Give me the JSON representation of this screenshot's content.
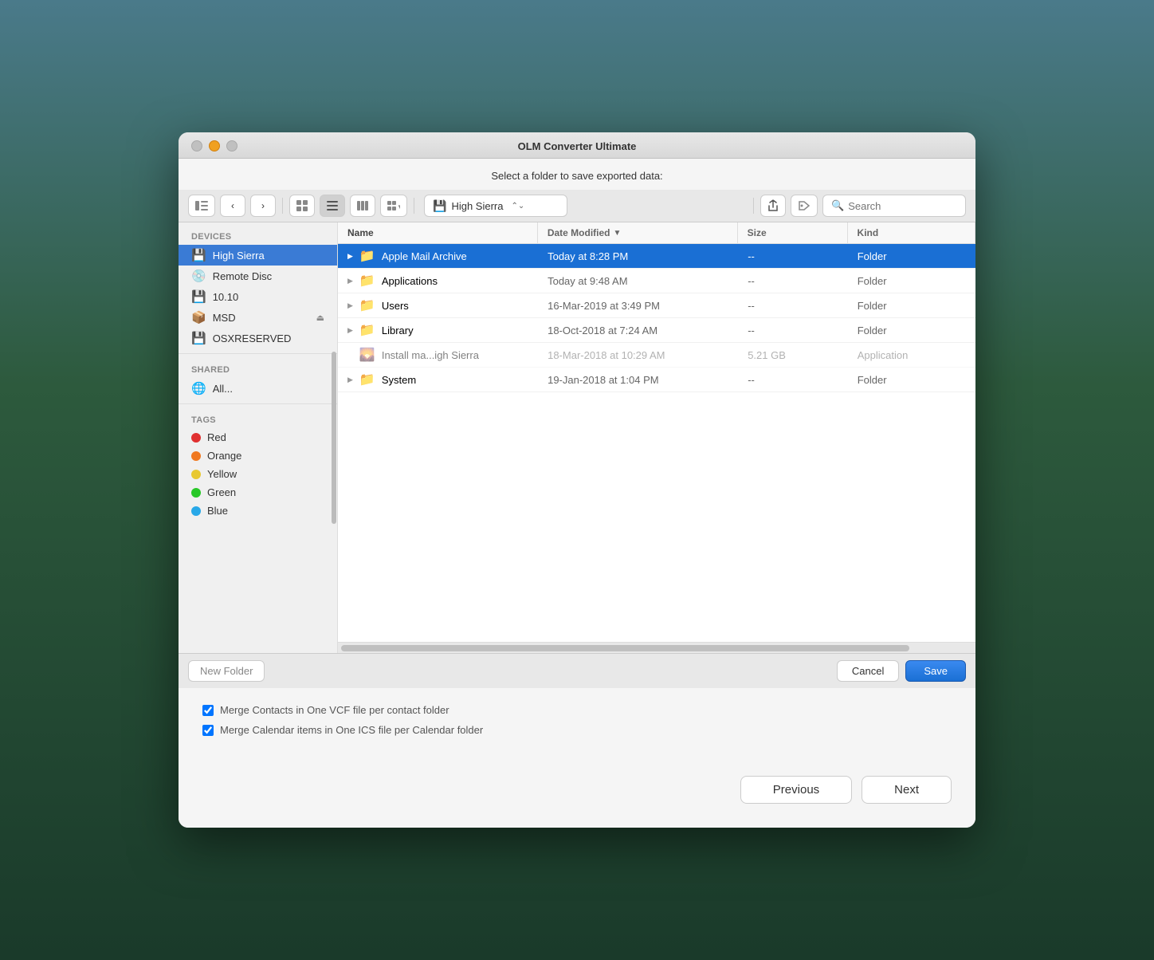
{
  "window": {
    "title": "OLM Converter Ultimate"
  },
  "dialog": {
    "header": "Select a folder to save exported data:"
  },
  "toolbar": {
    "location": "High Sierra",
    "location_icon": "💾",
    "search_placeholder": "Search",
    "btn_sidebar": "⊞",
    "btn_back": "‹",
    "btn_forward": "›",
    "btn_icon_view": "⊞",
    "btn_list_view": "≡",
    "btn_column_view": "⊟",
    "btn_group_view": "⊞",
    "btn_share": "↑",
    "btn_tag": "○"
  },
  "sidebar": {
    "devices_label": "Devices",
    "items_devices": [
      {
        "id": "high-sierra",
        "label": "High Sierra",
        "icon": "💾",
        "active": true
      },
      {
        "id": "remote-disc",
        "label": "Remote Disc",
        "icon": "💿",
        "active": false
      },
      {
        "id": "10-10",
        "label": "10.10",
        "icon": "💾",
        "active": false
      },
      {
        "id": "msd",
        "label": "MSD",
        "icon": "📦",
        "active": false,
        "eject": true
      },
      {
        "id": "osxreserved",
        "label": "OSXRESERVED",
        "icon": "💾",
        "active": false
      }
    ],
    "shared_label": "Shared",
    "items_shared": [
      {
        "id": "all",
        "label": "All...",
        "icon": "🌐",
        "active": false
      }
    ],
    "tags_label": "Tags",
    "items_tags": [
      {
        "id": "red",
        "label": "Red",
        "color": "#e03030"
      },
      {
        "id": "orange",
        "label": "Orange",
        "color": "#f07820"
      },
      {
        "id": "yellow",
        "label": "Yellow",
        "color": "#e8c830"
      },
      {
        "id": "green",
        "label": "Green",
        "color": "#28c828"
      },
      {
        "id": "blue",
        "label": "Blue",
        "color": "#28a8e8"
      }
    ]
  },
  "file_list": {
    "columns": {
      "name": "Name",
      "date_modified": "Date Modified",
      "size": "Size",
      "kind": "Kind"
    },
    "rows": [
      {
        "id": "apple-mail-archive",
        "name": "Apple Mail Archive",
        "icon": "📁",
        "date": "Today at 8:28 PM",
        "size": "--",
        "kind": "Folder",
        "selected": true,
        "expanded": true
      },
      {
        "id": "applications",
        "name": "Applications",
        "icon": "📁",
        "date": "Today at 9:48 AM",
        "size": "--",
        "kind": "Folder",
        "selected": false,
        "expanded": false
      },
      {
        "id": "users",
        "name": "Users",
        "icon": "📁",
        "date": "16-Mar-2019 at 3:49 PM",
        "size": "--",
        "kind": "Folder",
        "selected": false,
        "expanded": false
      },
      {
        "id": "library",
        "name": "Library",
        "icon": "📁",
        "date": "18-Oct-2018 at 7:24 AM",
        "size": "--",
        "kind": "Folder",
        "selected": false,
        "expanded": false
      },
      {
        "id": "install-macos",
        "name": "Install ma...igh Sierra",
        "icon": "📦",
        "date": "18-Mar-2018 at 10:29 AM",
        "size": "5.21 GB",
        "kind": "Application",
        "selected": false,
        "expanded": false,
        "disabled": true
      },
      {
        "id": "system",
        "name": "System",
        "icon": "📁",
        "date": "19-Jan-2018 at 1:04 PM",
        "size": "--",
        "kind": "Folder",
        "selected": false,
        "expanded": false
      }
    ]
  },
  "bottom_bar": {
    "new_folder": "New Folder",
    "cancel": "Cancel",
    "save": "Save"
  },
  "checkboxes": [
    {
      "id": "merge-contacts",
      "label": "Merge Contacts in One VCF file per contact folder",
      "checked": true
    },
    {
      "id": "merge-calendar",
      "label": "Merge Calendar items in One ICS file per Calendar folder",
      "checked": true
    }
  ],
  "navigation": {
    "previous": "Previous",
    "next": "Next"
  }
}
